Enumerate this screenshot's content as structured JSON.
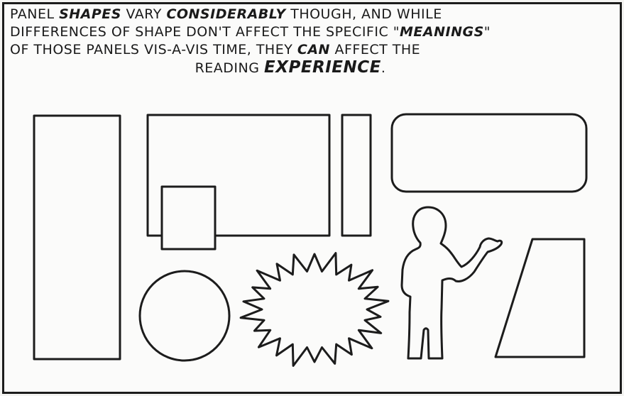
{
  "caption": {
    "line1": {
      "t1": "PANEL ",
      "e1": "SHAPES",
      "t2": " VARY ",
      "e2": "CONSIDERABLY",
      "t3": " THOUGH, AND WHILE"
    },
    "line2": {
      "t1": "DIFFERENCES OF SHAPE DON'T AFFECT THE SPECIFIC \"",
      "e1": "MEANINGS",
      "t2": "\""
    },
    "line3": {
      "t1": "OF THOSE PANELS VIS-A-VIS TIME, THEY ",
      "e1": "CAN",
      "t2": " AFFECT THE"
    },
    "line4": {
      "t1": "READING ",
      "e1": "EXPERIENCE",
      "t2": "."
    }
  },
  "shapes": [
    "tall-rectangle",
    "wide-rectangle",
    "small-square",
    "narrow-rectangle",
    "rounded-rectangle",
    "person-silhouette",
    "trapezoid",
    "circle",
    "starburst"
  ]
}
